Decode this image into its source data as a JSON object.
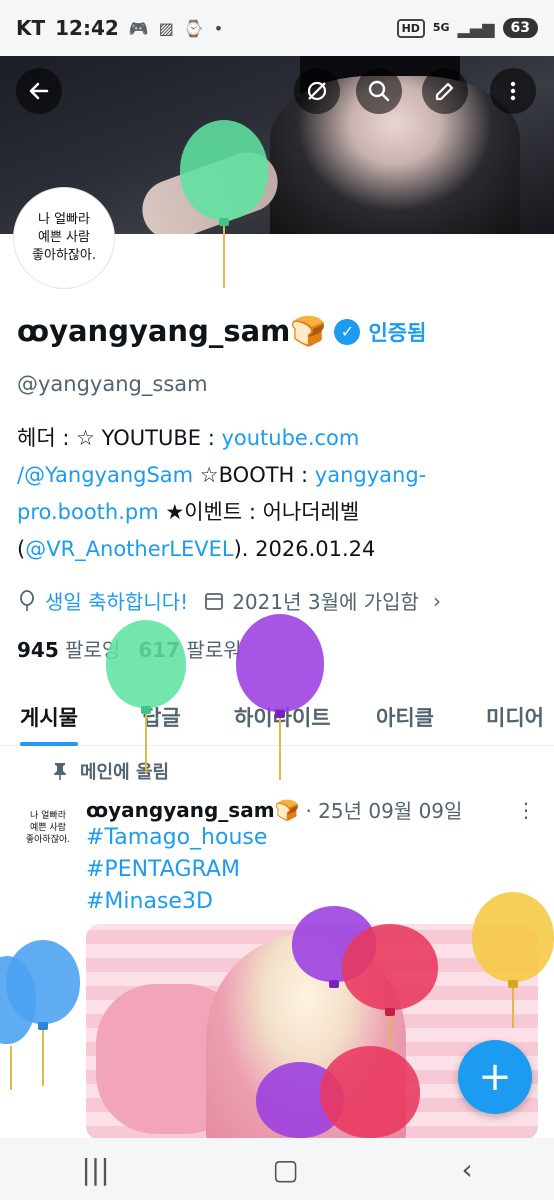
{
  "status_bar": {
    "carrier": "KT",
    "time": "12:42",
    "hd_label": "HD",
    "network": "5G",
    "battery": "63"
  },
  "avatar": {
    "line1": "나 얼빠라",
    "line2": "예쁜 사람",
    "line3": "좋아하잖아."
  },
  "profile": {
    "display_name": "ꝏyangyang_sam🍞",
    "verified_label": "인증됨",
    "handle": "@yangyang_ssam",
    "bio_prefix": "헤더 :  ☆ YOUTUBE : ",
    "bio_youtube": "youtube.com /@YangyangSam",
    "bio_booth_prefix": " ☆BOOTH : ",
    "bio_booth": "yangyang-pro.booth.pm",
    "bio_event_prefix": "  ★이벤트 : 어나더레벨(",
    "bio_event_link": "@VR_AnotherLEVEL",
    "bio_event_suffix": "). 2026.01.24",
    "birthday": "생일 축하합니다!",
    "joined": "2021년 3월에 가입함",
    "following_count": "945",
    "following_label": "팔로잉",
    "followers_count": "617",
    "followers_label": "팔로워"
  },
  "tabs": [
    {
      "label": "게시물"
    },
    {
      "label": "답글"
    },
    {
      "label": "하이라이트"
    },
    {
      "label": "아티클"
    },
    {
      "label": "미디어"
    }
  ],
  "pinned_post": {
    "pinned_label": "메인에 올림",
    "author": "ꝏyangyang_sam🍞",
    "date": "· 25년 09월 09일",
    "hashtags": [
      "#Tamago_house",
      "#PENTAGRAM",
      "#Minase3D"
    ]
  },
  "colors": {
    "accent": "#1d9bf0",
    "muted": "#536471",
    "balloon_green": "#5fe3a1",
    "balloon_purple": "#9a3de0",
    "balloon_blue": "#4aa0f0",
    "balloon_red": "#e8385f",
    "balloon_yellow": "#f5c842"
  },
  "icons": [
    "back-arrow-icon",
    "grok-icon",
    "search-icon",
    "edit-icon",
    "more-vert-icon",
    "balloon-icon",
    "calendar-icon",
    "pin-icon",
    "plus-icon"
  ]
}
